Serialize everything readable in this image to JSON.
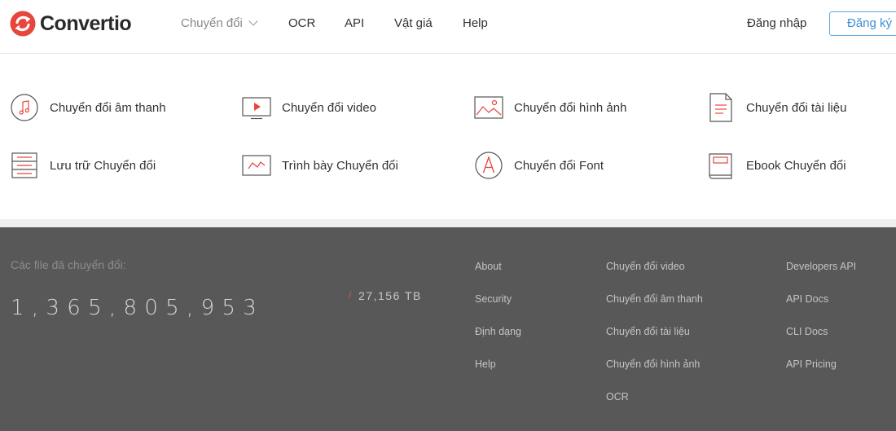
{
  "header": {
    "logo_text": "Convertio",
    "nav": [
      {
        "label": "Chuyển đổi",
        "has_dropdown": true
      },
      {
        "label": "OCR"
      },
      {
        "label": "API"
      },
      {
        "label": "Vật giá"
      },
      {
        "label": "Help"
      }
    ],
    "login_label": "Đăng nhập",
    "signup_label": "Đăng ký"
  },
  "colors": {
    "brand_red": "#e8453c",
    "accent_blue": "#3d8fd6",
    "footer_bg": "#585858"
  },
  "converters": [
    {
      "label": "Chuyển đổi âm thanh",
      "icon": "music-note-icon"
    },
    {
      "label": "Chuyển đổi video",
      "icon": "video-play-icon"
    },
    {
      "label": "Chuyển đổi hình ảnh",
      "icon": "image-icon"
    },
    {
      "label": "Chuyển đổi tài liệu",
      "icon": "document-icon"
    },
    {
      "label": "Lưu trữ Chuyển đổi",
      "icon": "archive-icon"
    },
    {
      "label": "Trình bày Chuyển đổi",
      "icon": "presentation-icon"
    },
    {
      "label": "Chuyển đổi Font",
      "icon": "font-icon"
    },
    {
      "label": "Ebook Chuyển đổi",
      "icon": "ebook-icon"
    }
  ],
  "footer": {
    "stat_label": "Các file đã chuyển đổi:",
    "file_count": "1,365,805,953",
    "data_size": "27,156 TB",
    "col1": [
      "About",
      "Security",
      "Định dạng",
      "Help"
    ],
    "col2": [
      "Chuyển đổi video",
      "Chuyển đổi âm thanh",
      "Chuyển đổi tài liệu",
      "Chuyển đổi hình ảnh",
      "OCR"
    ],
    "col3": [
      "Developers API",
      "API Docs",
      "CLI Docs",
      "API Pricing"
    ]
  }
}
